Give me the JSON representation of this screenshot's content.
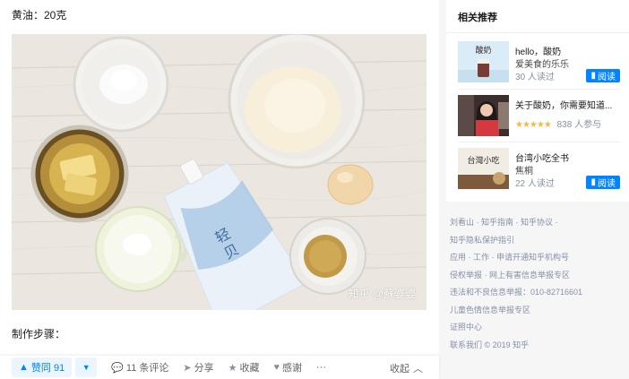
{
  "article": {
    "ingredient_line": "黄油：20克",
    "watermark": "知乎 @蘇婆婆",
    "steps_title": "制作步骤："
  },
  "actions": {
    "vote_up": "赞同 91",
    "comments": "11 条评论",
    "share": "分享",
    "favorite": "收藏",
    "thanks": "感谢",
    "more": "···",
    "collapse": "收起"
  },
  "sidebar": {
    "title": "相关推荐",
    "items": [
      {
        "title": "hello，酸奶",
        "subtitle": "爱美食的乐乐",
        "meta": "30 人读过",
        "button": "阅读",
        "cover_text": "酸奶"
      },
      {
        "title": "关于酸奶，你需要知道...",
        "rating": "★★★★★",
        "meta": "838 人参与",
        "button": ""
      },
      {
        "title": "台湾小吃全书",
        "subtitle": "焦桐",
        "meta": "22 人读过",
        "button": "阅读",
        "cover_text": "台灣小吃"
      }
    ]
  },
  "footer": {
    "rows": [
      "刘看山 · 知乎指南 · 知乎协议 ·",
      "知乎隐私保护指引",
      "应用 · 工作 · 申请开通知乎机构号",
      "侵权举报 · 网上有害信息举报专区",
      "违法和不良信息举报：010-82716601",
      "儿童色情信息举报专区",
      "证照中心",
      "联系我们 © 2019 知乎"
    ]
  },
  "colors": {
    "accent": "#0084ff",
    "star": "#f6b64a",
    "meta": "#8590a6"
  },
  "icons": [
    "caret-up-icon",
    "caret-down-icon",
    "comment-icon",
    "share-icon",
    "star-icon",
    "heart-icon",
    "chevron-up-icon",
    "book-icon"
  ]
}
